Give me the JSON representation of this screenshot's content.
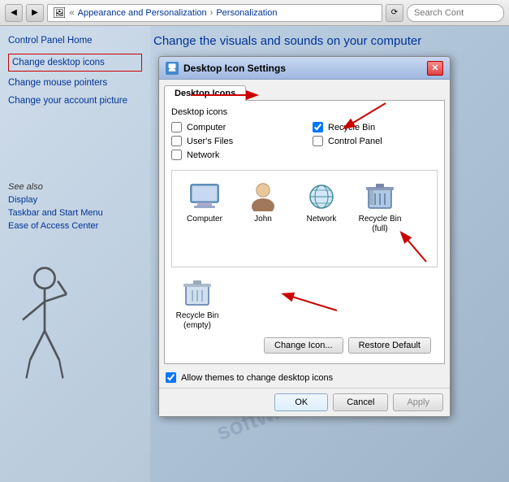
{
  "addressBar": {
    "back": "◀",
    "forward": "▶",
    "breadcrumb": [
      "Appearance and Personalization",
      "Personalization"
    ],
    "searchPlaceholder": "Search Cont"
  },
  "sidebar": {
    "home": "Control Panel Home",
    "links": [
      {
        "id": "change-desktop-icons",
        "label": "Change desktop icons",
        "active": true
      },
      {
        "id": "change-mouse-pointers",
        "label": "Change mouse pointers",
        "active": false
      },
      {
        "id": "change-account-picture",
        "label": "Change your account picture",
        "active": false
      }
    ],
    "seeAlso": {
      "label": "See also",
      "items": [
        {
          "id": "display",
          "label": "Display"
        },
        {
          "id": "taskbar",
          "label": "Taskbar and Start Menu"
        },
        {
          "id": "ease-of-access",
          "label": "Ease of Access Center"
        }
      ]
    }
  },
  "pageTitle": "Change the visuals and sounds on your computer",
  "dialog": {
    "title": "Desktop Icon Settings",
    "tab": "Desktop Icons",
    "section": "Desktop icons",
    "checkboxes": [
      {
        "id": "computer",
        "label": "Computer",
        "checked": false
      },
      {
        "id": "users-files",
        "label": "User's Files",
        "checked": false
      },
      {
        "id": "network",
        "label": "Network",
        "checked": false
      },
      {
        "id": "recycle-bin",
        "label": "Recycle Bin",
        "checked": true
      },
      {
        "id": "control-panel",
        "label": "Control Panel",
        "checked": false
      }
    ],
    "icons": [
      {
        "id": "computer-icon",
        "label": "Computer",
        "symbol": "🖥"
      },
      {
        "id": "john-icon",
        "label": "John",
        "symbol": "👤"
      },
      {
        "id": "network-icon",
        "label": "Network",
        "symbol": "🌐"
      },
      {
        "id": "recycle-full-icon",
        "label": "Recycle Bin\n(full)",
        "symbol": "🗑"
      },
      {
        "id": "recycle-empty-icon",
        "label": "Recycle Bin\n(empty)",
        "symbol": "🗑"
      }
    ],
    "buttons": {
      "changeIcon": "Change Icon...",
      "restoreDefault": "Restore Default",
      "allowThemes": "Allow themes to change desktop icons",
      "ok": "OK",
      "cancel": "Cancel",
      "apply": "Apply"
    }
  }
}
